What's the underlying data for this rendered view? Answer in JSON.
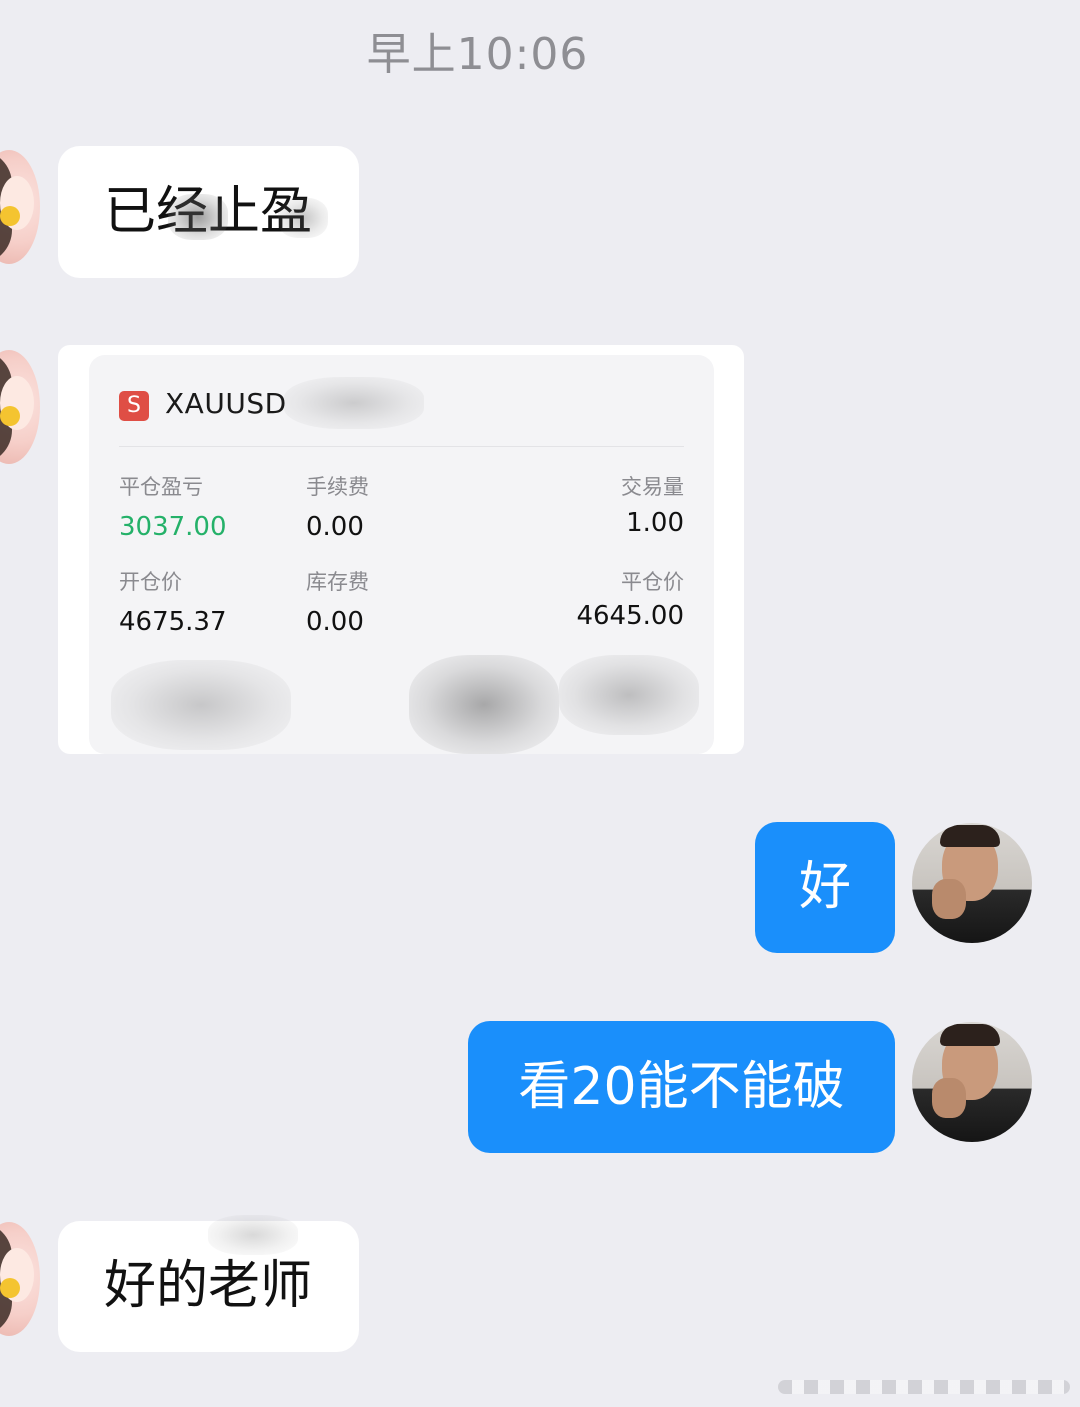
{
  "chat": {
    "timestamp": "早上10:06",
    "messages": [
      {
        "side": "in",
        "text": "已经止盈"
      },
      {
        "side": "in",
        "type": "trade-card"
      },
      {
        "side": "out",
        "text": "好"
      },
      {
        "side": "out",
        "text": "看20能不能破"
      },
      {
        "side": "in",
        "text": "好的老师"
      }
    ]
  },
  "trade_card": {
    "symbol_badge": "S",
    "symbol": "XAUUSD",
    "fields": {
      "close_pnl_label": "平仓盈亏",
      "close_pnl_value": "3037.00",
      "fee_label": "手续费",
      "fee_value": "0.00",
      "volume_label": "交易量",
      "volume_value": "1.00",
      "open_price_label": "开仓价",
      "open_price_value": "4675.37",
      "swap_label": "库存费",
      "swap_value": "0.00",
      "close_price_label": "平仓价",
      "close_price_value": "4645.00"
    }
  },
  "colors": {
    "background": "#ededf2",
    "incoming_bubble": "#ffffff",
    "outgoing_bubble": "#1a8ffb",
    "profit_green": "#24b169",
    "badge_red": "#df4e45"
  }
}
